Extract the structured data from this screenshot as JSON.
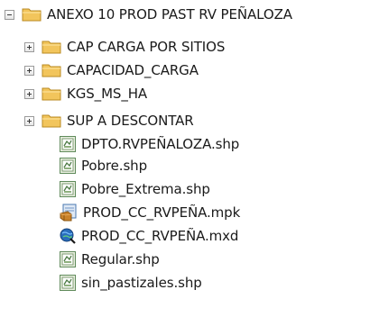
{
  "tree": {
    "root": {
      "label": "ANEXO 10 PROD PAST RV PEÑALOZA",
      "icon": "folder-icon",
      "state": "expanded"
    },
    "folders": [
      {
        "label": "CAP CARGA POR SITIOS",
        "icon": "folder-icon",
        "state": "collapsed"
      },
      {
        "label": "CAPACIDAD_CARGA",
        "icon": "folder-icon",
        "state": "collapsed"
      },
      {
        "label": "KGS_MS_HA",
        "icon": "folder-icon",
        "state": "collapsed"
      },
      {
        "label": "SUP A DESCONTAR",
        "icon": "folder-icon",
        "state": "collapsed"
      }
    ],
    "files": [
      {
        "label": "DPTO.RVPEÑALOZA.shp",
        "icon": "shapefile-icon"
      },
      {
        "label": "Pobre.shp",
        "icon": "shapefile-icon"
      },
      {
        "label": "Pobre_Extrema.shp",
        "icon": "shapefile-icon"
      },
      {
        "label": "PROD_CC_RVPEÑA.mpk",
        "icon": "map-package-icon"
      },
      {
        "label": "PROD_CC_RVPEÑA.mxd",
        "icon": "map-document-icon"
      },
      {
        "label": "Regular.shp",
        "icon": "shapefile-icon"
      },
      {
        "label": "sin_pastizales.shp",
        "icon": "shapefile-icon"
      }
    ]
  },
  "colors": {
    "folder": "#f2c55c",
    "folder_dark": "#d9a531",
    "shapefile_frame": "#5f8a5a",
    "map_document": "#1f5fa8"
  }
}
